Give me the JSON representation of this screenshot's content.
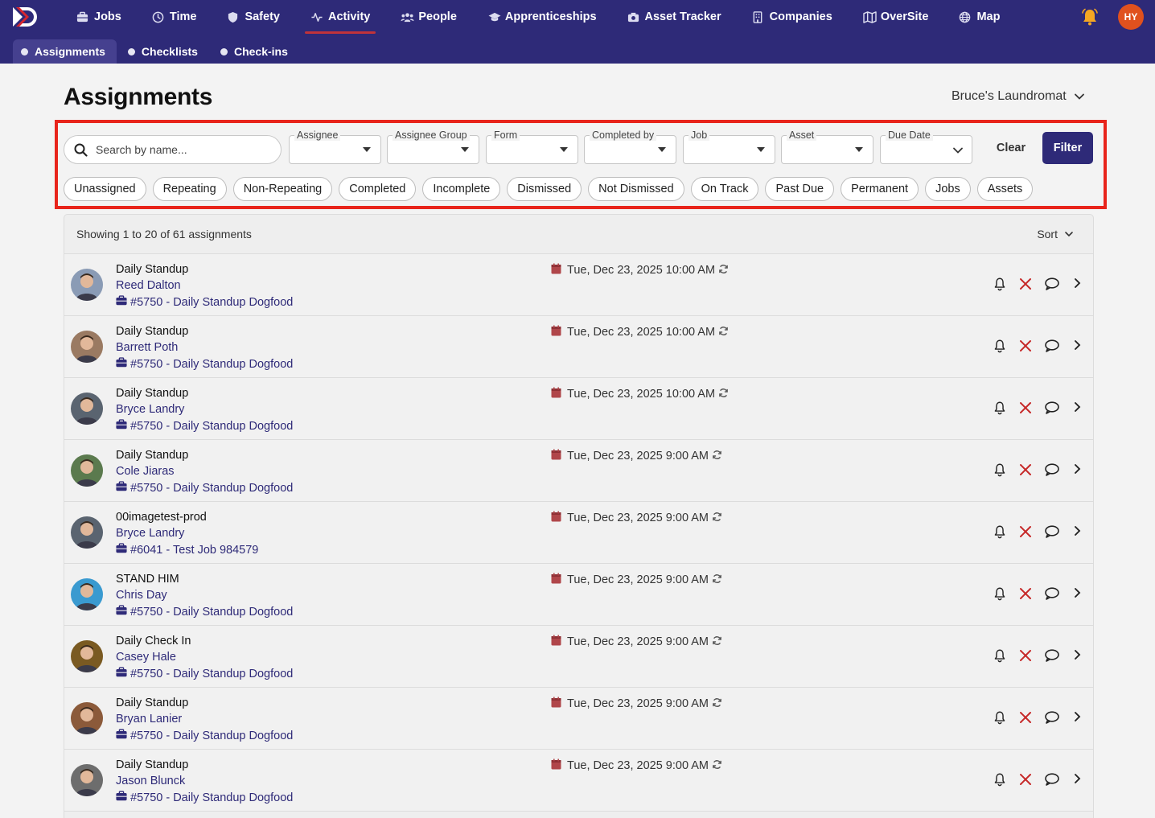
{
  "nav": {
    "items": [
      {
        "label": "Jobs",
        "icon": "briefcase-icon"
      },
      {
        "label": "Time",
        "icon": "clock-icon"
      },
      {
        "label": "Safety",
        "icon": "shield-icon"
      },
      {
        "label": "Activity",
        "icon": "activity-icon"
      },
      {
        "label": "People",
        "icon": "people-icon"
      },
      {
        "label": "Apprenticeships",
        "icon": "graduation-cap-icon"
      },
      {
        "label": "Asset Tracker",
        "icon": "camera-icon"
      },
      {
        "label": "Companies",
        "icon": "building-icon"
      },
      {
        "label": "OverSite",
        "icon": "map-fold-icon"
      },
      {
        "label": "Map",
        "icon": "globe-icon"
      }
    ],
    "active": "Activity",
    "user_initials": "HY",
    "accent": "#2e2a78",
    "active_underline": "#c0333a",
    "avatar_color": "#e0511e",
    "bell_color": "#f5a623"
  },
  "subnav": {
    "items": [
      "Assignments",
      "Checklists",
      "Check-ins"
    ],
    "active": "Assignments"
  },
  "page": {
    "title": "Assignments",
    "company": "Bruce's Laundromat"
  },
  "filters": {
    "search_placeholder": "Search by name...",
    "dropdowns": [
      "Assignee",
      "Assignee Group",
      "Form",
      "Completed by",
      "Job",
      "Asset",
      "Due Date"
    ],
    "clear_label": "Clear",
    "filter_label": "Filter",
    "chips": [
      "Unassigned",
      "Repeating",
      "Non-Repeating",
      "Completed",
      "Incomplete",
      "Dismissed",
      "Not Dismissed",
      "On Track",
      "Past Due",
      "Permanent",
      "Jobs",
      "Assets"
    ],
    "highlight_color": "#e8241b"
  },
  "list": {
    "summary": "Showing 1 to 20 of 61 assignments",
    "sort_label": "Sort",
    "rows": [
      {
        "title": "Daily Standup",
        "person": "Reed Dalton",
        "job": "#5750 - Daily Standup Dogfood",
        "due": "Tue, Dec 23, 2025 10:00 AM",
        "avatar": "#8a9bb5"
      },
      {
        "title": "Daily Standup",
        "person": "Barrett Poth",
        "job": "#5750 - Daily Standup Dogfood",
        "due": "Tue, Dec 23, 2025 10:00 AM",
        "avatar": "#9a7a62"
      },
      {
        "title": "Daily Standup",
        "person": "Bryce Landry",
        "job": "#5750 - Daily Standup Dogfood",
        "due": "Tue, Dec 23, 2025 10:00 AM",
        "avatar": "#5a6470"
      },
      {
        "title": "Daily Standup",
        "person": "Cole Jiaras",
        "job": "#5750 - Daily Standup Dogfood",
        "due": "Tue, Dec 23, 2025 9:00 AM",
        "avatar": "#5b7a4e"
      },
      {
        "title": "00imagetest-prod",
        "person": "Bryce Landry",
        "job": "#6041 - Test Job 984579",
        "due": "Tue, Dec 23, 2025 9:00 AM",
        "avatar": "#5a6470"
      },
      {
        "title": "STAND HIM",
        "person": "Chris Day",
        "job": "#5750 - Daily Standup Dogfood",
        "due": "Tue, Dec 23, 2025 9:00 AM",
        "avatar": "#3a9ad0"
      },
      {
        "title": "Daily Check In",
        "person": "Casey Hale",
        "job": "#5750 - Daily Standup Dogfood",
        "due": "Tue, Dec 23, 2025 9:00 AM",
        "avatar": "#7a5a22"
      },
      {
        "title": "Daily Standup",
        "person": "Bryan Lanier",
        "job": "#5750 - Daily Standup Dogfood",
        "due": "Tue, Dec 23, 2025 9:00 AM",
        "avatar": "#8b5a3a"
      },
      {
        "title": "Daily Standup",
        "person": "Jason Blunck",
        "job": "#5750 - Daily Standup Dogfood",
        "due": "Tue, Dec 23, 2025 9:00 AM",
        "avatar": "#6d6d6d"
      }
    ],
    "job_color": "#2e2a78",
    "calendar_color": "#b0464a",
    "dismiss_color": "#c62828"
  }
}
